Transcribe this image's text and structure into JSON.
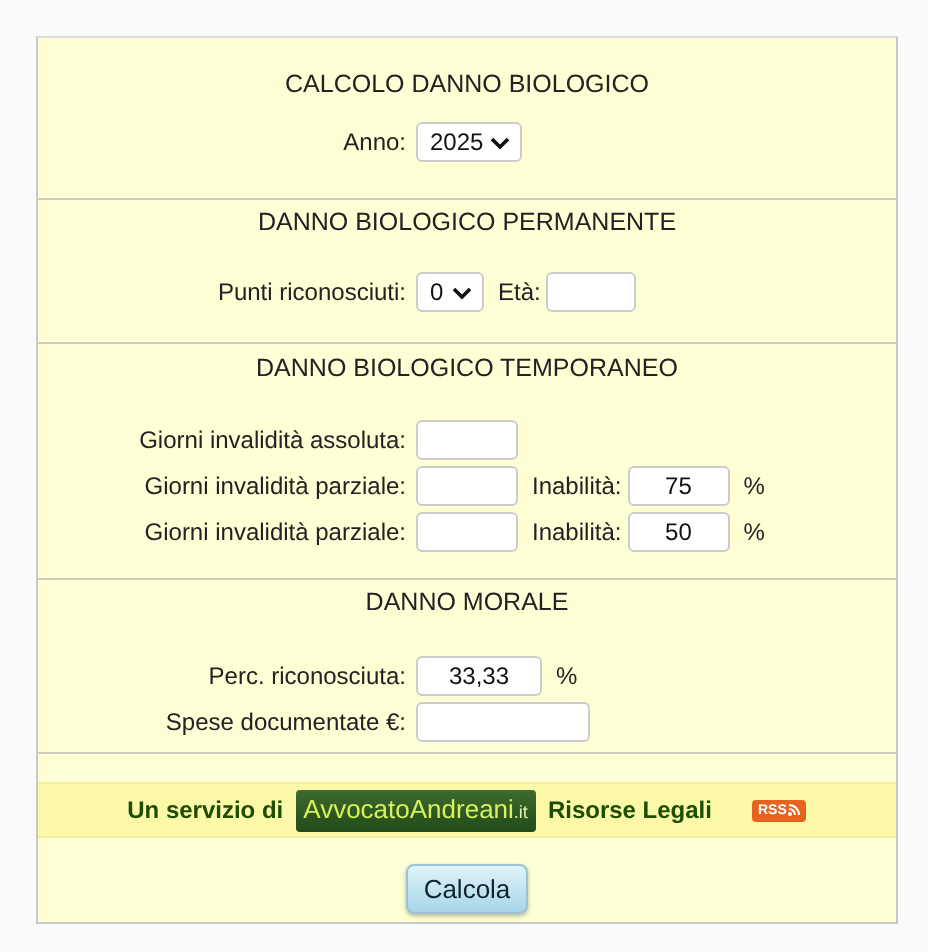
{
  "sections": [
    {
      "title": "CALCOLO DANNO BIOLOGICO",
      "rows": [
        [
          {
            "kind": "label",
            "text": "Anno:"
          },
          {
            "kind": "select",
            "value": "2025"
          }
        ]
      ]
    },
    {
      "title": "DANNO BIOLOGICO PERMANENTE",
      "rows": [
        [
          {
            "kind": "label",
            "text": "Punti riconosciuti:"
          },
          {
            "kind": "select",
            "value": "0"
          },
          {
            "kind": "text",
            "text": "Età:"
          },
          {
            "kind": "input"
          }
        ]
      ]
    },
    {
      "title": "DANNO BIOLOGICO TEMPORANEO",
      "rows": [
        [
          {
            "kind": "label",
            "text": "Giorni invalidità assoluta:"
          },
          {
            "kind": "input"
          }
        ],
        [
          {
            "kind": "label",
            "text": "Giorni invalidità parziale:"
          },
          {
            "kind": "input"
          },
          {
            "kind": "text",
            "text": "Inabilità:"
          },
          {
            "kind": "input",
            "value": "75"
          },
          {
            "kind": "text",
            "text": "%"
          }
        ],
        [
          {
            "kind": "label",
            "text": "Giorni invalidità parziale:"
          },
          {
            "kind": "input"
          },
          {
            "kind": "text",
            "text": "Inabilità:"
          },
          {
            "kind": "input",
            "value": "50"
          },
          {
            "kind": "text",
            "text": "%"
          }
        ]
      ]
    },
    {
      "title": "DANNO MORALE",
      "rows": [
        [
          {
            "kind": "label",
            "text": "Perc. riconosciuta:"
          },
          {
            "kind": "input",
            "value": "33,33"
          },
          {
            "kind": "text",
            "text": "%"
          }
        ],
        [
          {
            "kind": "label",
            "text": "Spese documentate €:"
          },
          {
            "kind": "input"
          }
        ]
      ]
    }
  ],
  "banner": {
    "prefix": "Un servizio di",
    "logo_name": "AvvocatoAndreani",
    "logo_tld": ".it",
    "link": "Risorse Legali",
    "rss": "RSS"
  },
  "button": "Calcola"
}
